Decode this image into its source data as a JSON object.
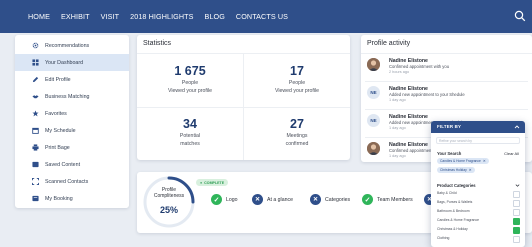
{
  "nav": {
    "items": [
      "HOME",
      "EXHIBIT",
      "VISIT",
      "2018 HIGHLIGHTS",
      "BLOG",
      "CONTACTS US"
    ],
    "search_icon": "search-icon"
  },
  "sidebar": {
    "items": [
      {
        "label": "Recommendations",
        "icon": "gear-icon"
      },
      {
        "label": "Your Dashboard",
        "icon": "dashboard-icon",
        "active": true
      },
      {
        "label": "Edit Profile",
        "icon": "pencil-icon"
      },
      {
        "label": "Business Matching",
        "icon": "handshake-icon"
      },
      {
        "label": "Favorites",
        "icon": "star-icon"
      },
      {
        "label": "My Schedule",
        "icon": "calendar-icon"
      },
      {
        "label": "Print Bage",
        "icon": "printer-icon"
      },
      {
        "label": "Saved Content",
        "icon": "bookmark-icon"
      },
      {
        "label": "Scanned Contacts",
        "icon": "scan-icon"
      },
      {
        "label": "My Booking",
        "icon": "booking-icon"
      }
    ]
  },
  "stats": {
    "title": "Statistics",
    "items": [
      {
        "value": "1 675",
        "label_line1": "People",
        "label_line2": "Viewed your profile"
      },
      {
        "value": "17",
        "label_line1": "People",
        "label_line2": "Viewed your profile"
      },
      {
        "value": "34",
        "label_line1": "Potential",
        "label_line2": "matches"
      },
      {
        "value": "27",
        "label_line1": "Meetings",
        "label_line2": "confirmed"
      }
    ]
  },
  "activity": {
    "title": "Profile activity",
    "items": [
      {
        "avatar": "photo",
        "name": "Nadine Elistone",
        "desc": "Confirmed appointment with you",
        "time": "2 hours ago"
      },
      {
        "avatar": "NE",
        "name": "Nadine Elistone",
        "desc": "Added new appointment to your Shedule",
        "time": "1 day ago"
      },
      {
        "avatar": "NE",
        "name": "Nadine Elistone",
        "desc": "Added new appointment to your Shedule",
        "time": "1 day ago"
      },
      {
        "avatar": "photo",
        "name": "Nadine Elistone",
        "desc": "Confirmed appointment with you",
        "time": "1 day ago"
      }
    ]
  },
  "progress": {
    "title_line1": "Profile",
    "title_line2": "Compliteness",
    "percent": "25%",
    "percent_value": 25,
    "badge": "COMPLETE",
    "steps": [
      {
        "label": "Logo",
        "done": true
      },
      {
        "label": "At a glance",
        "done": false
      },
      {
        "label": "Categories",
        "done": false
      },
      {
        "label": "Team Members",
        "done": true
      }
    ]
  },
  "filter": {
    "title": "FILTER BY",
    "placeholder": "Refine your search by",
    "your_search": "Your Search",
    "clear": "Clear All",
    "tags": [
      "Candles & Home Fragrance",
      "Christmas Holiday"
    ],
    "categories_title": "Product Categories",
    "categories": [
      "Baby & Child",
      "Bags, Purses & Wallets",
      "Bathroom & Bedroom",
      "Candles & Home Fragrance",
      "Christmas & Holiday",
      "Clothing"
    ],
    "checked": [
      false,
      false,
      false,
      true,
      true,
      false
    ]
  },
  "colors": {
    "nav": "#2f4f8a",
    "accent": "#1f3b6e",
    "success": "#2fb55a",
    "background": "#e9edf3"
  }
}
